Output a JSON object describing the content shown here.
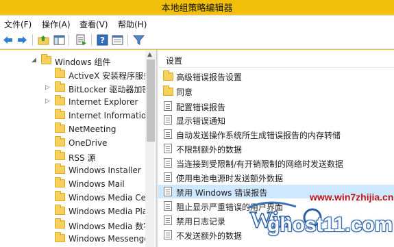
{
  "window": {
    "title": "本地组策略编辑器"
  },
  "menu": [
    {
      "label": "文件(F)"
    },
    {
      "label": "操作(A)"
    },
    {
      "label": "查看(V)"
    },
    {
      "label": "帮助(H)"
    }
  ],
  "toolbar": [
    {
      "icon": "back-arrow-icon"
    },
    {
      "icon": "forward-arrow-icon"
    },
    {
      "icon": "up-folder-icon"
    },
    {
      "icon": "show-hide-tree-icon"
    },
    {
      "icon": "export-list-icon"
    },
    {
      "icon": "help-icon"
    },
    {
      "icon": "properties-icon"
    },
    {
      "icon": "filter-icon"
    }
  ],
  "tree": {
    "items": [
      {
        "label": "Windows 组件",
        "expanded": true
      },
      {
        "label": "ActiveX 安装程序服务"
      },
      {
        "label": "BitLocker 驱动器加密",
        "expandable": true
      },
      {
        "label": "Internet Explorer",
        "expandable": true
      },
      {
        "label": "Internet Information Services"
      },
      {
        "label": "NetMeeting"
      },
      {
        "label": "OneDrive"
      },
      {
        "label": "RSS 源"
      },
      {
        "label": "Windows Installer"
      },
      {
        "label": "Windows Mail"
      },
      {
        "label": "Windows Media Center"
      },
      {
        "label": "Windows Media Player"
      },
      {
        "label": "Windows Media 数字权限管理"
      },
      {
        "label": "Windows Messenger"
      }
    ]
  },
  "list": {
    "header": "设置",
    "items": [
      {
        "label": "高级错误报告设置",
        "type": "folder"
      },
      {
        "label": "同意",
        "type": "folder"
      },
      {
        "label": "配置错误报告",
        "type": "setting"
      },
      {
        "label": "显示错误通知",
        "type": "setting"
      },
      {
        "label": "自动发送操作系统所生成错误报告的内存转储",
        "type": "setting"
      },
      {
        "label": "不限制额外的数据",
        "type": "setting"
      },
      {
        "label": "当连接到受限制/有开销限制的网络时发送数据",
        "type": "setting"
      },
      {
        "label": "使用电池电源时发送额外数据",
        "type": "setting"
      },
      {
        "label": "禁用 Windows 错误报告",
        "type": "setting",
        "selected": true
      },
      {
        "label": "阻止显示严重错误的用户界面",
        "type": "setting"
      },
      {
        "label": "禁用日志记录",
        "type": "setting"
      },
      {
        "label": "不发送额外的数据",
        "type": "setting"
      }
    ]
  },
  "watermark": {
    "url": "www.win7zhijia.cn",
    "site": "ghost11.com"
  },
  "colors": {
    "titlebar": "#f2c00a",
    "selection": "#cde8ff",
    "folder": "#f5d05a"
  }
}
